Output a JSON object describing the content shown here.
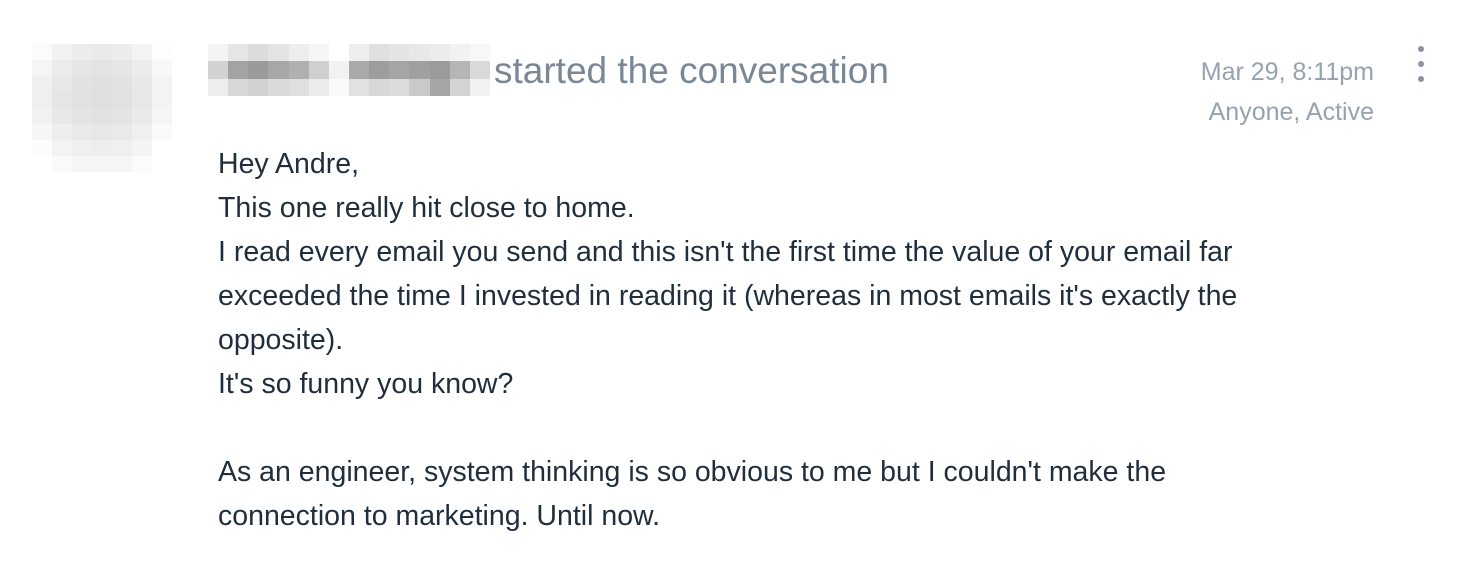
{
  "conversation": {
    "headline": "started the conversation",
    "timestamp": "Mar 29, 8:11pm",
    "visibility": "Anyone, Active",
    "menu_icon": "vertical-ellipsis-icon",
    "avatar_redacted": true,
    "author_name_redacted": true
  },
  "message": {
    "lines": [
      "Hey Andre,",
      "This one really hit close to home.",
      "I read every email you send and this isn't the first time the value of your email far",
      "exceeded the time I invested in reading it (whereas in most emails it's exactly the",
      "opposite).",
      "It's so funny you know?",
      "",
      "As an engineer, system thinking is so obvious to me but I couldn't make the",
      "connection to marketing. Until now."
    ]
  },
  "colors": {
    "headline": "#7a8797",
    "meta": "#95a2b1",
    "body_text": "#1f2d3d",
    "menu_dots": "#8994a3"
  }
}
